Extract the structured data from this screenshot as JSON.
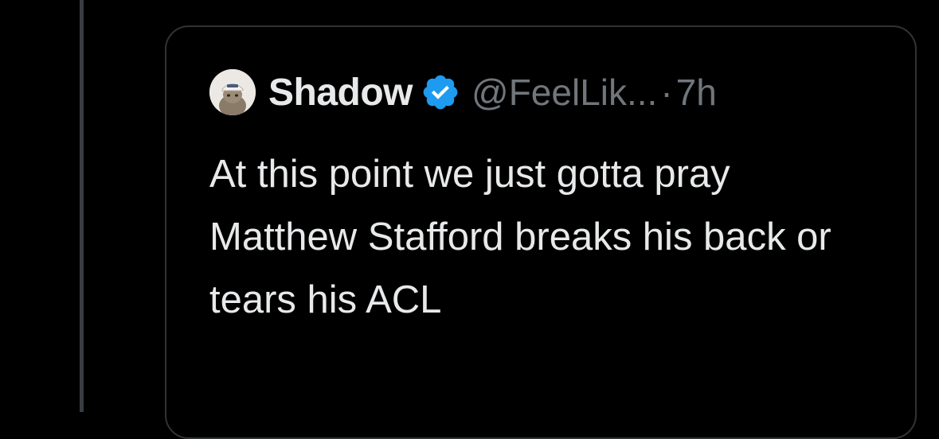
{
  "quoted_tweet": {
    "display_name": "Shadow",
    "handle": "@FeelLik...",
    "separator": "·",
    "timestamp": "7h",
    "text": "At this point we just gotta pray Matthew Stafford breaks his back or tears his ACL",
    "verified": true,
    "verified_color": "#1d9bf0",
    "avatar_icon": "cat-with-cap-avatar"
  },
  "colors": {
    "background": "#000000",
    "primary_text": "#e7e9ea",
    "secondary_text": "#71767b",
    "border": "#2f3336"
  }
}
